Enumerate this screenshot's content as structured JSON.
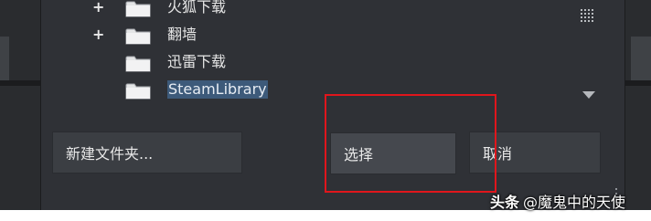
{
  "tree": {
    "items": [
      {
        "label": "火狐下载",
        "expander": "+",
        "selected": false
      },
      {
        "label": "翻墙",
        "expander": "+",
        "selected": false
      },
      {
        "label": "迅雷下载",
        "expander": "",
        "selected": false
      },
      {
        "label": "SteamLibrary",
        "expander": "",
        "selected": true
      }
    ]
  },
  "buttons": {
    "new_folder": "新建文件夹...",
    "select": "选择",
    "cancel": "取消"
  },
  "watermark": {
    "logo": "头条",
    "text": "@魔鬼中的天使"
  },
  "colors": {
    "dialog_bg": "#2f3136",
    "selection": "#3d5a7a",
    "highlight_box": "#e0161c"
  }
}
